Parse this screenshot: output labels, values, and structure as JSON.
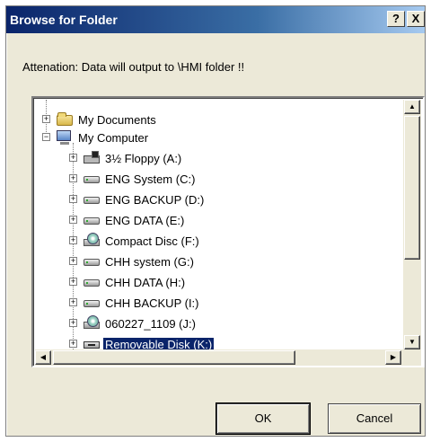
{
  "window": {
    "title": "Browse for Folder",
    "help_button": "?",
    "close_button": "X"
  },
  "message": "Attenation: Data will output to \\HMI folder !!",
  "tree": {
    "items": [
      {
        "label": "My Documents",
        "icon": "folder-icon",
        "expander": "+"
      },
      {
        "label": "My Computer",
        "icon": "computer-icon",
        "expander": "−"
      },
      {
        "label": "3½ Floppy (A:)",
        "icon": "floppy-icon",
        "expander": "+"
      },
      {
        "label": "ENG System (C:)",
        "icon": "drive-icon",
        "expander": "+"
      },
      {
        "label": "ENG BACKUP (D:)",
        "icon": "drive-icon",
        "expander": "+"
      },
      {
        "label": "ENG DATA (E:)",
        "icon": "drive-icon",
        "expander": "+"
      },
      {
        "label": "Compact Disc (F:)",
        "icon": "cd-icon",
        "expander": "+"
      },
      {
        "label": "CHH system (G:)",
        "icon": "drive-icon",
        "expander": "+"
      },
      {
        "label": "CHH DATA (H:)",
        "icon": "drive-icon",
        "expander": "+"
      },
      {
        "label": "CHH BACKUP (I:)",
        "icon": "drive-icon",
        "expander": "+"
      },
      {
        "label": "060227_1109 (J:)",
        "icon": "cd-icon",
        "expander": "+"
      },
      {
        "label": "Removable Disk (K:)",
        "icon": "removable-icon",
        "expander": "+",
        "selected": true
      }
    ]
  },
  "scrollbars": {
    "up_arrow": "▲",
    "down_arrow": "▼",
    "left_arrow": "◀",
    "right_arrow": "▶"
  },
  "buttons": {
    "ok": "OK",
    "cancel": "Cancel"
  },
  "colors": {
    "selection": "#0a246a",
    "dialog_bg": "#ece9d8",
    "titlebar": "#0a246a"
  }
}
